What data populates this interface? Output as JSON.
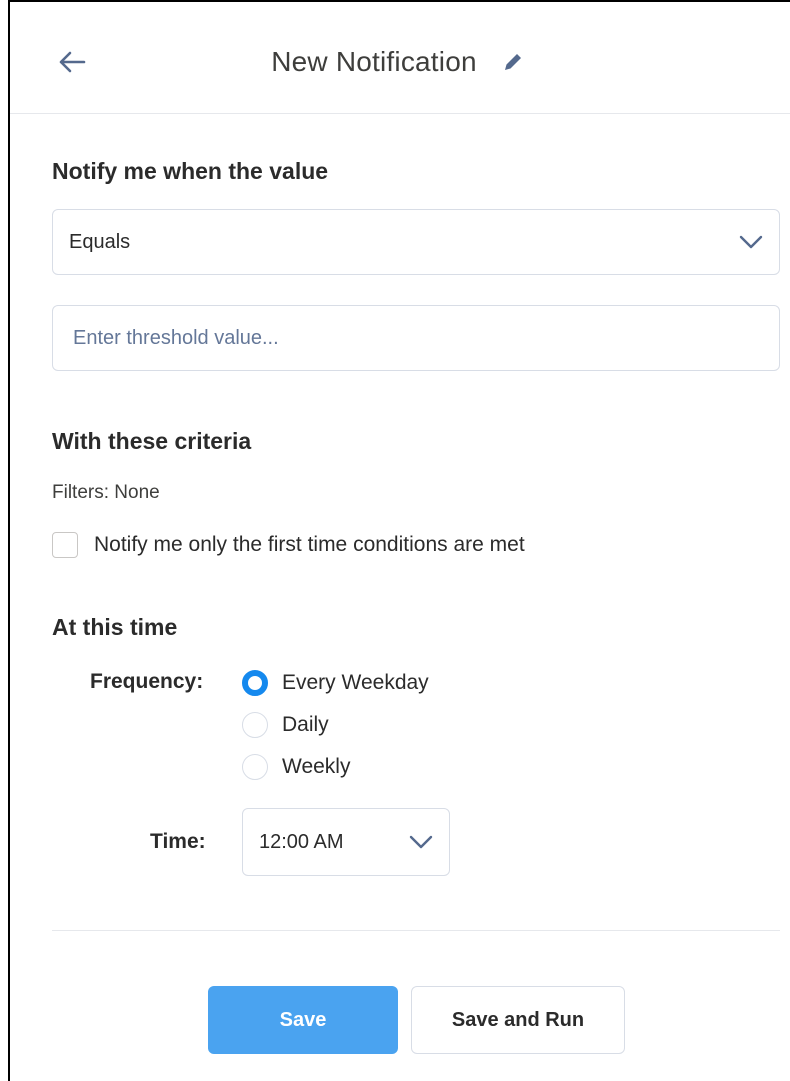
{
  "header": {
    "title": "New Notification",
    "back_icon": "arrow-left-icon",
    "edit_icon": "pencil-icon"
  },
  "notify": {
    "section_title": "Notify me when the value",
    "operator_value": "Equals",
    "threshold_placeholder": "Enter threshold value..."
  },
  "criteria": {
    "section_title": "With these criteria",
    "filters_text": "Filters: None",
    "first_time_label": "Notify me only the first time conditions are met",
    "first_time_checked": false
  },
  "schedule": {
    "section_title": "At this time",
    "frequency_label": "Frequency:",
    "frequency_options": [
      {
        "label": "Every Weekday",
        "selected": true
      },
      {
        "label": "Daily",
        "selected": false
      },
      {
        "label": "Weekly",
        "selected": false
      }
    ],
    "time_label": "Time:",
    "time_value": "12:00 AM"
  },
  "actions": {
    "save_label": "Save",
    "save_run_label": "Save and Run"
  },
  "colors": {
    "accent": "#1589ee",
    "save_button": "#4aa3f0",
    "border": "#d8dde6"
  }
}
